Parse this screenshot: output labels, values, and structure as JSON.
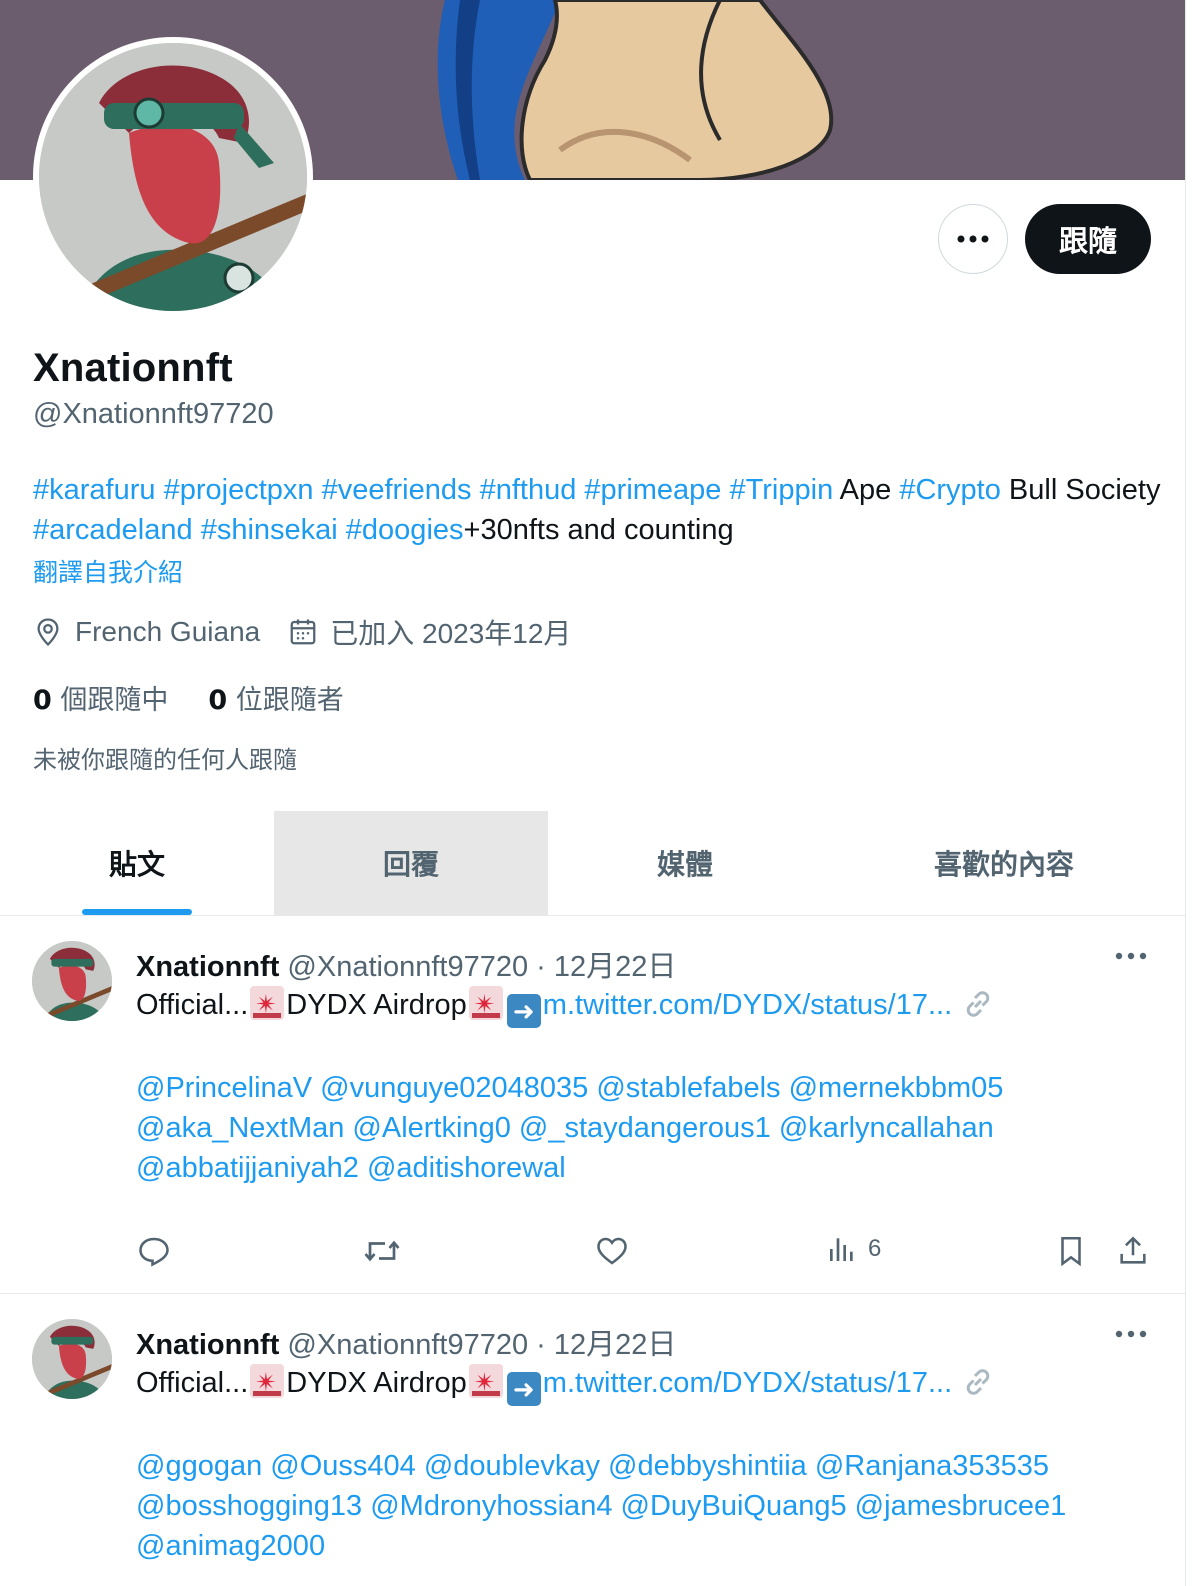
{
  "profile": {
    "display_name": "Xnationnft",
    "handle": "@Xnationnft97720",
    "follow_label": "跟隨",
    "bio": {
      "segments": [
        {
          "text": "#karafuru",
          "tag": true
        },
        {
          "text": " ",
          "tag": false
        },
        {
          "text": "#projectpxn",
          "tag": true
        },
        {
          "text": " ",
          "tag": false
        },
        {
          "text": "#veefriends",
          "tag": true
        },
        {
          "text": " ",
          "tag": false
        },
        {
          "text": "#nfthud",
          "tag": true
        },
        {
          "text": " ",
          "tag": false
        },
        {
          "text": "#primeape",
          "tag": true
        },
        {
          "text": " ",
          "tag": false
        },
        {
          "text": "#Trippin",
          "tag": true
        },
        {
          "text": " Ape ",
          "tag": false
        },
        {
          "text": "#Crypto",
          "tag": true
        },
        {
          "text": " Bull Society ",
          "tag": false
        },
        {
          "text": "#arcadeland",
          "tag": true
        },
        {
          "text": " ",
          "tag": false
        },
        {
          "text": "#shinsekai",
          "tag": true
        },
        {
          "text": " ",
          "tag": false
        },
        {
          "text": "#doogies",
          "tag": true
        },
        {
          "text": "+30nfts and counting",
          "tag": false
        }
      ]
    },
    "translate_label": "翻譯自我介紹",
    "location": "French Guiana",
    "joined": "已加入 2023年12月",
    "following_count": "0",
    "following_label": " 個跟隨中",
    "followers_count": "0",
    "followers_label": " 位跟隨者",
    "not_followed_note": "未被你跟隨的任何人跟隨"
  },
  "tabs": [
    {
      "label": "貼文",
      "active": true
    },
    {
      "label": "回覆",
      "active": false
    },
    {
      "label": "媒體",
      "active": false
    },
    {
      "label": "喜歡的內容",
      "active": false
    }
  ],
  "tweets": [
    {
      "name": "Xnationnft",
      "handle": "@Xnationnft97720",
      "date": " · 12月22日",
      "text_prefix": "Official...",
      "text_mid": "DYDX Airdrop",
      "link": "m.twitter.com/DYDX/status/17...",
      "mentions": "@PrincelinaV @vunguye02048035 @stablefabels @mernekbbm05 @aka_NextMan @Alertking0 @_staydangerous1 @karlyncallahan @abbatijjaniyah2 @aditishorewal",
      "views": "6"
    },
    {
      "name": "Xnationnft",
      "handle": "@Xnationnft97720",
      "date": " · 12月22日",
      "text_prefix": "Official...",
      "text_mid": "DYDX Airdrop",
      "link": "m.twitter.com/DYDX/status/17...",
      "mentions": "@ggogan @Ouss404 @doublevkay @debbyshintiia @Ranjana353535 @bosshogging13 @Mdronyhossian4 @DuyBuiQuang5 @jamesbrucee1 @animag2000"
    }
  ],
  "colors": {
    "accent": "#1d9bf0",
    "banner": "#6c5d6e",
    "text_secondary": "#536471"
  }
}
